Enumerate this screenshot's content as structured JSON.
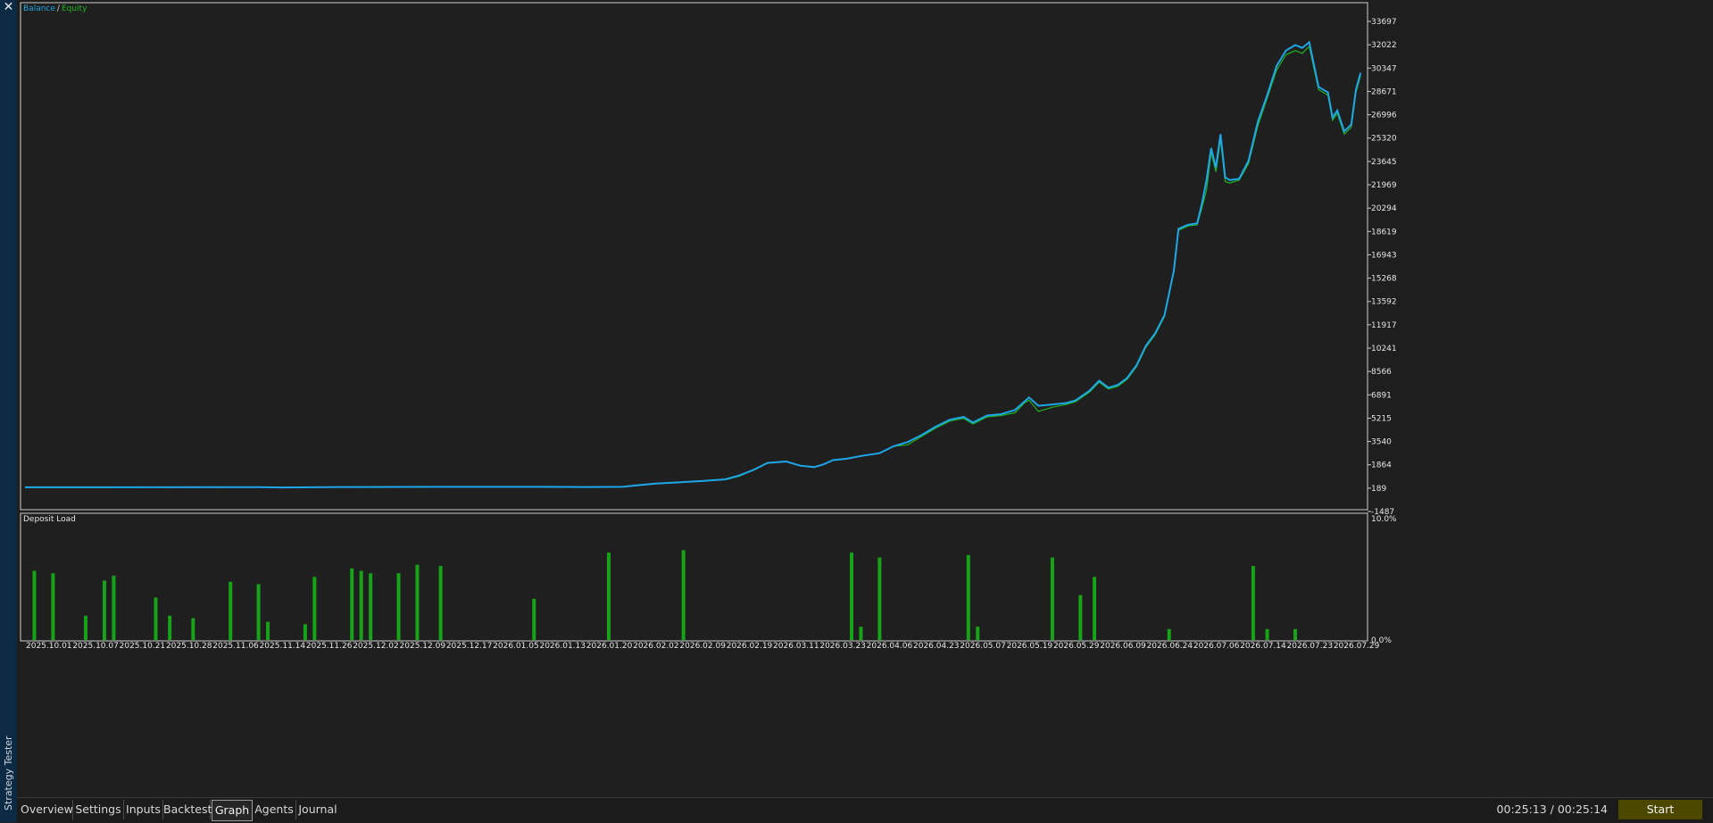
{
  "sidebar": {
    "title": "Strategy Tester",
    "close_glyph": "✕"
  },
  "legend": {
    "balance": "Balance",
    "separator": "/",
    "equity": "Equity"
  },
  "colors": {
    "balance": "#1ea7e8",
    "equity": "#1fb51f",
    "bars": "#17a317",
    "background": "#1e1e1e",
    "start_button": "#4d4800"
  },
  "deposit_title": "Deposit Load",
  "tabs": [
    {
      "label": "Overview",
      "active": false
    },
    {
      "label": "Settings",
      "active": false
    },
    {
      "label": "Inputs",
      "active": false
    },
    {
      "label": "Backtest",
      "active": false
    },
    {
      "label": "Graph",
      "active": true
    },
    {
      "label": "Agents",
      "active": false
    },
    {
      "label": "Journal",
      "active": false
    }
  ],
  "timer": "00:25:13 / 00:25:14",
  "start_label": "Start",
  "chart_data": [
    {
      "type": "line",
      "legend_placement": "top-left",
      "grid": false,
      "x_ticks": [
        "2025.10.01",
        "2025.10.07",
        "2025.10.21",
        "2025.10.28",
        "2025.11.06",
        "2025.11.14",
        "2025.11.26",
        "2025.12.02",
        "2025.12.09",
        "2025.12.17",
        "2026.01.05",
        "2026.01.13",
        "2026.01.20",
        "2026.02.02",
        "2026.02.09",
        "2026.02.19",
        "2026.03.11",
        "2026.03.23",
        "2026.04.06",
        "2026.04.23",
        "2026.05.07",
        "2026.05.19",
        "2026.05.29",
        "2026.06.09",
        "2026.06.24",
        "2026.07.06",
        "2026.07.14",
        "2026.07.23",
        "2026.07.29"
      ],
      "y_ticks": [
        "33697",
        "32022",
        "30347",
        "28671",
        "26996",
        "25320",
        "23645",
        "21969",
        "20294",
        "18619",
        "16943",
        "15268",
        "13592",
        "11917",
        "10241",
        "8566",
        "6891",
        "5215",
        "3540",
        "1864",
        "189",
        "-1487"
      ],
      "ylim": [
        -1487,
        33697
      ],
      "xlim": [
        0,
        28.5
      ],
      "series": [
        {
          "name": "Balance",
          "points": [
            [
              0,
              250
            ],
            [
              5,
              260
            ],
            [
              5.5,
              240
            ],
            [
              7,
              270
            ],
            [
              9,
              285
            ],
            [
              11,
              280
            ],
            [
              12,
              270
            ],
            [
              12.8,
              280
            ],
            [
              13,
              350
            ],
            [
              13.5,
              520
            ],
            [
              14,
              600
            ],
            [
              14.5,
              700
            ],
            [
              15,
              820
            ],
            [
              15.3,
              1100
            ],
            [
              15.6,
              1500
            ],
            [
              15.9,
              2000
            ],
            [
              16.3,
              2100
            ],
            [
              16.6,
              1800
            ],
            [
              16.9,
              1700
            ],
            [
              17.1,
              1900
            ],
            [
              17.3,
              2200
            ],
            [
              17.6,
              2300
            ],
            [
              17.9,
              2500
            ],
            [
              18.3,
              2700
            ],
            [
              18.6,
              3200
            ],
            [
              18.9,
              3500
            ],
            [
              19.2,
              4000
            ],
            [
              19.5,
              4600
            ],
            [
              19.8,
              5100
            ],
            [
              20.1,
              5300
            ],
            [
              20.3,
              4900
            ],
            [
              20.6,
              5400
            ],
            [
              20.9,
              5500
            ],
            [
              21.2,
              5800
            ],
            [
              21.4,
              6400
            ],
            [
              21.5,
              6700
            ],
            [
              21.7,
              6100
            ],
            [
              22,
              6200
            ],
            [
              22.3,
              6300
            ],
            [
              22.5,
              6500
            ],
            [
              22.8,
              7200
            ],
            [
              23,
              7900
            ],
            [
              23.2,
              7400
            ],
            [
              23.4,
              7600
            ],
            [
              23.6,
              8100
            ],
            [
              23.8,
              9000
            ],
            [
              24,
              10400
            ],
            [
              24.2,
              11300
            ],
            [
              24.4,
              12600
            ],
            [
              24.6,
              15800
            ],
            [
              24.7,
              18800
            ],
            [
              24.9,
              19100
            ],
            [
              25.1,
              19200
            ],
            [
              25.2,
              20600
            ],
            [
              25.3,
              22300
            ],
            [
              25.4,
              24600
            ],
            [
              25.5,
              23200
            ],
            [
              25.6,
              25600
            ],
            [
              25.7,
              22500
            ],
            [
              25.8,
              22300
            ],
            [
              26,
              22400
            ],
            [
              26.2,
              23700
            ],
            [
              26.4,
              26500
            ],
            [
              26.6,
              28400
            ],
            [
              26.8,
              30500
            ],
            [
              27,
              31600
            ],
            [
              27.2,
              32000
            ],
            [
              27.35,
              31800
            ],
            [
              27.5,
              32200
            ],
            [
              27.7,
              29000
            ],
            [
              27.9,
              28600
            ],
            [
              28,
              26800
            ],
            [
              28.1,
              27300
            ],
            [
              28.25,
              25800
            ],
            [
              28.4,
              26300
            ],
            [
              28.5,
              28800
            ],
            [
              28.6,
              30000
            ]
          ]
        },
        {
          "name": "Equity",
          "points": [
            [
              0,
              250
            ],
            [
              5,
              260
            ],
            [
              5.5,
              240
            ],
            [
              7,
              270
            ],
            [
              9,
              285
            ],
            [
              11,
              280
            ],
            [
              12,
              270
            ],
            [
              12.8,
              280
            ],
            [
              13,
              350
            ],
            [
              13.5,
              500
            ],
            [
              14,
              600
            ],
            [
              14.5,
              700
            ],
            [
              15,
              800
            ],
            [
              15.3,
              1050
            ],
            [
              15.6,
              1500
            ],
            [
              15.9,
              2000
            ],
            [
              16.3,
              2100
            ],
            [
              16.6,
              1800
            ],
            [
              16.9,
              1700
            ],
            [
              17.1,
              1900
            ],
            [
              17.3,
              2200
            ],
            [
              17.6,
              2300
            ],
            [
              17.9,
              2500
            ],
            [
              18.3,
              2700
            ],
            [
              18.6,
              3200
            ],
            [
              18.9,
              3300
            ],
            [
              19.2,
              3900
            ],
            [
              19.5,
              4500
            ],
            [
              19.8,
              5000
            ],
            [
              20.1,
              5200
            ],
            [
              20.3,
              4800
            ],
            [
              20.6,
              5300
            ],
            [
              20.9,
              5400
            ],
            [
              21.2,
              5600
            ],
            [
              21.4,
              6300
            ],
            [
              21.5,
              6500
            ],
            [
              21.7,
              5700
            ],
            [
              22,
              6000
            ],
            [
              22.3,
              6200
            ],
            [
              22.5,
              6400
            ],
            [
              22.8,
              7100
            ],
            [
              23,
              7800
            ],
            [
              23.2,
              7300
            ],
            [
              23.4,
              7500
            ],
            [
              23.6,
              8000
            ],
            [
              23.8,
              8900
            ],
            [
              24,
              10300
            ],
            [
              24.2,
              11200
            ],
            [
              24.4,
              12500
            ],
            [
              24.6,
              15700
            ],
            [
              24.7,
              18700
            ],
            [
              24.9,
              19000
            ],
            [
              25.1,
              19100
            ],
            [
              25.2,
              20300
            ],
            [
              25.3,
              21600
            ],
            [
              25.4,
              24300
            ],
            [
              25.5,
              22900
            ],
            [
              25.6,
              25200
            ],
            [
              25.7,
              22200
            ],
            [
              25.8,
              22100
            ],
            [
              26,
              22300
            ],
            [
              26.2,
              23500
            ],
            [
              26.4,
              26200
            ],
            [
              26.6,
              28200
            ],
            [
              26.8,
              30200
            ],
            [
              27,
              31300
            ],
            [
              27.2,
              31600
            ],
            [
              27.35,
              31400
            ],
            [
              27.5,
              31900
            ],
            [
              27.7,
              28800
            ],
            [
              27.9,
              28400
            ],
            [
              28,
              26600
            ],
            [
              28.1,
              27100
            ],
            [
              28.25,
              25600
            ],
            [
              28.4,
              26100
            ],
            [
              28.5,
              28600
            ],
            [
              28.6,
              29800
            ]
          ]
        }
      ]
    },
    {
      "type": "bar",
      "title": "Deposit Load",
      "y_ticks": [
        "10.0%",
        "0.0%"
      ],
      "ylim": [
        0,
        10
      ],
      "xlim": [
        0,
        28.5
      ],
      "bars": [
        [
          0.2,
          5.7
        ],
        [
          0.6,
          5.5
        ],
        [
          1.3,
          2.0
        ],
        [
          1.7,
          4.9
        ],
        [
          1.9,
          5.3
        ],
        [
          2.8,
          3.5
        ],
        [
          3.1,
          2.0
        ],
        [
          3.6,
          1.8
        ],
        [
          4.4,
          4.8
        ],
        [
          5.0,
          4.6
        ],
        [
          5.2,
          1.5
        ],
        [
          6.0,
          1.3
        ],
        [
          6.2,
          5.2
        ],
        [
          7.0,
          5.9
        ],
        [
          7.2,
          5.7
        ],
        [
          7.4,
          5.5
        ],
        [
          8.0,
          5.5
        ],
        [
          8.4,
          6.2
        ],
        [
          8.9,
          6.1
        ],
        [
          10.9,
          3.4
        ],
        [
          12.5,
          7.2
        ],
        [
          14.1,
          7.4
        ],
        [
          17.7,
          7.2
        ],
        [
          17.9,
          1.1
        ],
        [
          18.3,
          6.8
        ],
        [
          20.2,
          7.0
        ],
        [
          20.4,
          1.1
        ],
        [
          22.0,
          6.8
        ],
        [
          22.6,
          3.7
        ],
        [
          22.9,
          5.2
        ],
        [
          24.5,
          0.9
        ],
        [
          26.3,
          6.1
        ],
        [
          26.6,
          0.9
        ],
        [
          27.2,
          0.9
        ]
      ]
    }
  ]
}
